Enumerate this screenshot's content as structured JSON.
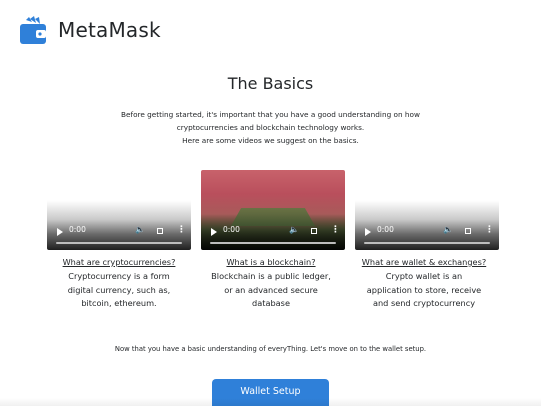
{
  "header": {
    "brand": "MetaMask",
    "logo_icon": "wallet-icon",
    "logo_color": "#2f80d9"
  },
  "main": {
    "title": "The Basics",
    "intro_lines": [
      "Before getting started, it's important that you have a good understanding on how",
      "cryptocurrencies and blockchain technology works.",
      "Here are some videos we suggest on the basics."
    ],
    "cards": [
      {
        "link": "What are cryptocurrencies?",
        "desc_lines": [
          "Cryptocurrency is a form",
          "digital currency, such as,",
          "bitcoin, ethereum."
        ],
        "video_time": "0:00"
      },
      {
        "link": "What is a blockchain?",
        "desc_lines": [
          "Blockchain is a public ledger,",
          "or an advanced secure",
          "database"
        ],
        "video_time": "0:00"
      },
      {
        "link": "What are wallet & exchanges?",
        "desc_lines": [
          "Crypto wallet is an",
          "application to store, receive",
          "and send cryptocurrency"
        ],
        "video_time": "0:00"
      }
    ],
    "footer_note": "Now that you have a basic understanding of everyThing. Let's move on to the wallet setup.",
    "setup_button": "Wallet Setup",
    "button_color": "#2f80d9"
  },
  "icons": {
    "play": "play-icon",
    "volume": "volume-icon",
    "fullscreen": "fullscreen-icon",
    "more": "more-options-icon"
  }
}
